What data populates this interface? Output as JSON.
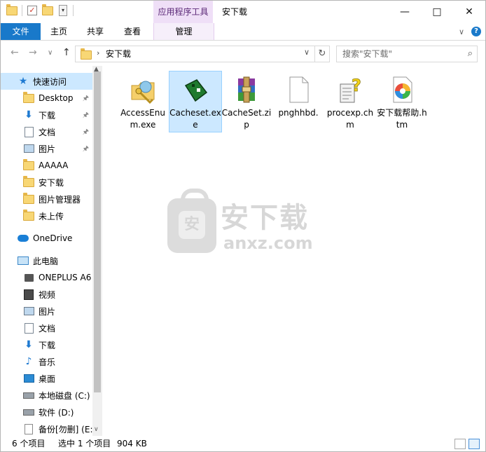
{
  "titlebar": {
    "context_tab": "应用程序工具",
    "title": "安下载"
  },
  "ribbon": {
    "tabs": [
      "文件",
      "主页",
      "共享",
      "查看"
    ],
    "context_tab": "管理"
  },
  "address": {
    "path": "安下载",
    "search_placeholder": "搜索\"安下载\""
  },
  "nav": {
    "quick_access": "快速访问",
    "items": [
      {
        "label": "Desktop",
        "icon": "folder",
        "pinned": true
      },
      {
        "label": "下载",
        "icon": "download",
        "pinned": true
      },
      {
        "label": "文档",
        "icon": "document",
        "pinned": true
      },
      {
        "label": "图片",
        "icon": "picture",
        "pinned": true
      },
      {
        "label": "AAAAA",
        "icon": "folder",
        "pinned": false
      },
      {
        "label": "安下载",
        "icon": "folder",
        "pinned": false
      },
      {
        "label": "图片管理器",
        "icon": "folder",
        "pinned": false
      },
      {
        "label": "未上传",
        "icon": "folder",
        "pinned": false
      }
    ],
    "onedrive": "OneDrive",
    "this_pc": "此电脑",
    "pc_items": [
      {
        "label": "ONEPLUS A6",
        "icon": "phone"
      },
      {
        "label": "视频",
        "icon": "video"
      },
      {
        "label": "图片",
        "icon": "picture"
      },
      {
        "label": "文档",
        "icon": "document"
      },
      {
        "label": "下载",
        "icon": "download"
      },
      {
        "label": "音乐",
        "icon": "music"
      },
      {
        "label": "桌面",
        "icon": "desktop"
      },
      {
        "label": "本地磁盘 (C:)",
        "icon": "drive"
      },
      {
        "label": "软件 (D:)",
        "icon": "drive"
      },
      {
        "label": "备份[勿删] (E:",
        "icon": "file"
      }
    ]
  },
  "files": [
    {
      "name": "AccessEnum.exe",
      "icon": "accessenum-icon",
      "selected": false
    },
    {
      "name": "Cacheset.exe",
      "icon": "cacheset-icon",
      "selected": true
    },
    {
      "name": "CacheSet.zip",
      "icon": "winrar-icon",
      "selected": false
    },
    {
      "name": "pnghhbd.",
      "icon": "blank-file-icon",
      "selected": false
    },
    {
      "name": "procexp.chm",
      "icon": "chm-help-icon",
      "selected": false
    },
    {
      "name": "安下载帮助.htm",
      "icon": "htm-icon",
      "selected": false
    }
  ],
  "watermark": {
    "text_cn": "安下载",
    "text_en": "anxz.com",
    "shield_char": "安"
  },
  "status": {
    "count": "6 个项目",
    "selection": "选中 1 个项目",
    "size": "904 KB"
  }
}
